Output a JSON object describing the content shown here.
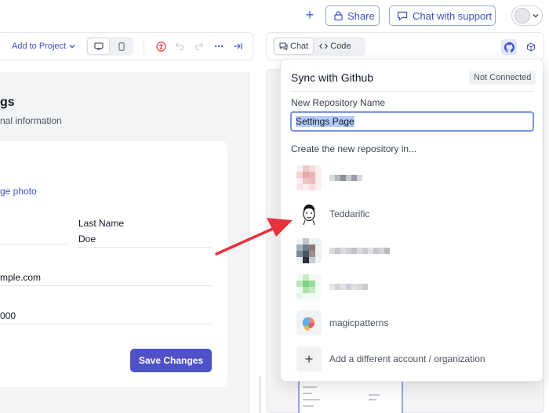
{
  "header": {
    "share_label": "Share",
    "support_label": "Chat with support"
  },
  "toolbar": {
    "add_project_label": "Add to Project",
    "chat_tab": "Chat",
    "code_tab": "Code"
  },
  "form": {
    "heading": "gs",
    "subtitle": "nal information",
    "change_photo": "ge photo",
    "last_name_label": "Last Name",
    "last_name_value": "Doe",
    "email_value": "mple.com",
    "phone_value": "000",
    "save_label": "Save Changes"
  },
  "github_popover": {
    "title": "Sync with Github",
    "status": "Not Connected",
    "repo_name_label": "New Repository Name",
    "repo_name_value": "Settings Page",
    "create_in_label": "Create the new repository in...",
    "accounts": [
      {
        "name": "Teddarific"
      },
      {
        "name": "magicpatterns"
      }
    ],
    "add_account_label": "Add a different account / organization"
  },
  "colors": {
    "accent": "#3b4fc4",
    "save_button": "#4f52c7",
    "annotation_arrow": "#e8323c"
  }
}
